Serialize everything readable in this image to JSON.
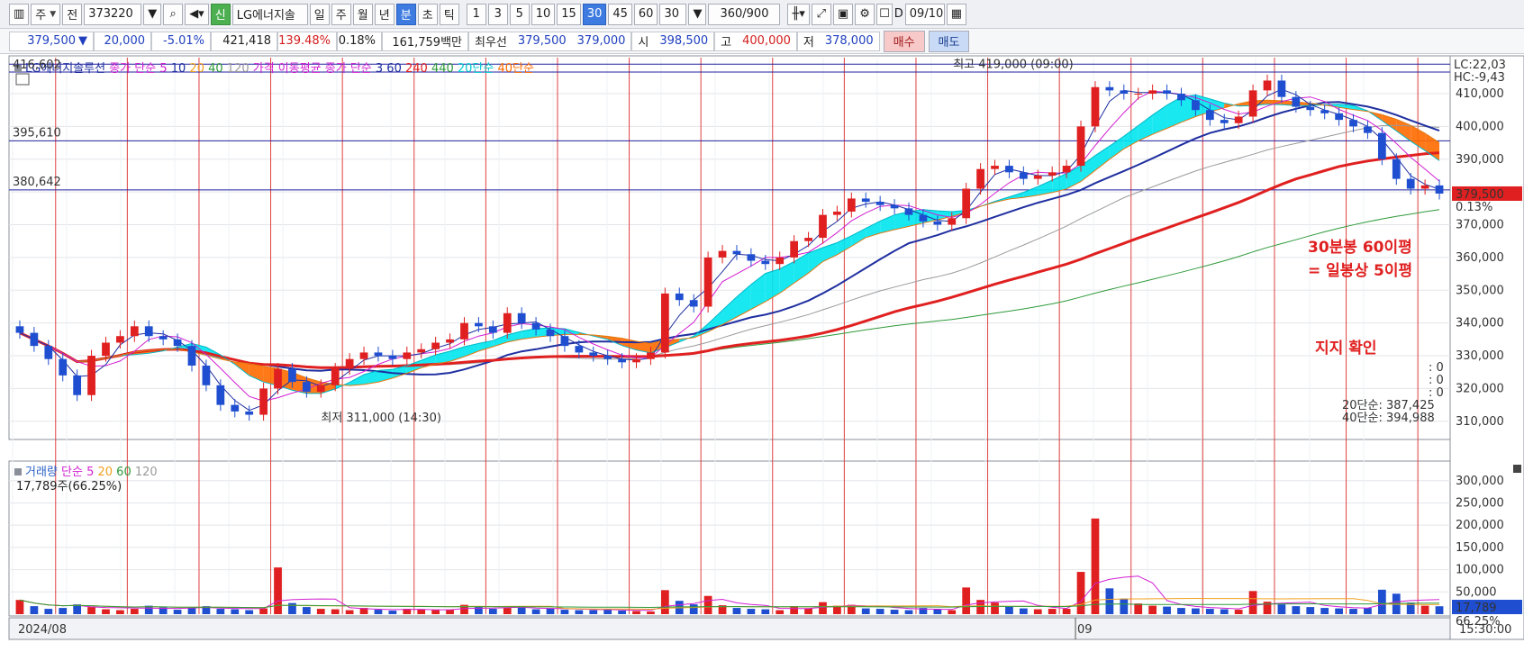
{
  "toolbar": {
    "period_combo": "주",
    "prev_label": "전",
    "code": "373220",
    "new_badge": "신",
    "stock_name": "LG에너지솔",
    "periods": [
      "일",
      "주",
      "월",
      "년",
      "분",
      "초",
      "틱"
    ],
    "active_period": "분",
    "minutes": [
      "1",
      "3",
      "5",
      "10",
      "15",
      "30",
      "45",
      "60"
    ],
    "active_minute": "30",
    "minute_combo": "30",
    "count_value": "360",
    "count_total": "/900",
    "checkbox_label": "D",
    "date": "09/10"
  },
  "quote": {
    "price": "379,500",
    "change_arrow": "▼",
    "change": "20,000",
    "change_rate": "-5.01%",
    "volume": "421,418",
    "volume_ratio": "139.48%",
    "turnover_rate": "0.18%",
    "amount": "161,759백만",
    "best_label": "최우선",
    "best_ask": "379,500",
    "best_bid": "379,000",
    "open_label": "시",
    "open": "398,500",
    "high_label": "고",
    "high": "400,000",
    "low_label": "저",
    "low": "378,000",
    "buy_label": "매수",
    "sell_label": "매도"
  },
  "colors": {
    "up": "#e02020",
    "down": "#1f4fd0",
    "ma5": "#d21fd2",
    "ma10": "#1f2fa0",
    "ma60": "#e02020",
    "ma120": "#9a9a9a",
    "ma240": "#e02020",
    "ma440": "#2e9a3a",
    "band_a": "#00e5ee",
    "band_b": "#ff6a00",
    "vline": "#e04040",
    "hline": "#2020a0"
  },
  "chart_data": {
    "type": "line",
    "price_legend_title": "LG에너지솔루션",
    "price_legend": [
      {
        "label": "종가 단순",
        "color": "#d21fd2"
      },
      {
        "label": "5",
        "color": "#d21fd2"
      },
      {
        "label": "10",
        "color": "#1f2fa0"
      },
      {
        "label": "20",
        "color": "#f0a020"
      },
      {
        "label": "40",
        "color": "#2e9a3a"
      },
      {
        "label": "120",
        "color": "#9a9a9a"
      },
      {
        "label": "가격 이동평균",
        "color": "#d21fd2"
      },
      {
        "label": "종가 단순",
        "color": "#d21fd2"
      },
      {
        "label": "3",
        "color": "#1f2fa0"
      },
      {
        "label": "60",
        "color": "#1f2fa0"
      },
      {
        "label": "240",
        "color": "#e02020"
      },
      {
        "label": "440",
        "color": "#2e9a3a"
      },
      {
        "label": "20단순",
        "color": "#00c8d0"
      },
      {
        "label": "40단순",
        "color": "#ff6a00"
      }
    ],
    "price_axis_ticks": [
      "410,000",
      "400,000",
      "390,000",
      "380,000",
      "370,000",
      "360,000",
      "350,000",
      "340,000",
      "330,000",
      "320,000",
      "310,000"
    ],
    "price_tick_values": [
      410000,
      400000,
      390000,
      380000,
      370000,
      360000,
      350000,
      340000,
      330000,
      320000,
      310000
    ],
    "ylim": [
      305000,
      421000
    ],
    "left_level_labels": [
      {
        "label": "416,602",
        "value": 416602
      },
      {
        "label": "395,610",
        "value": 395610
      },
      {
        "label": "380,642",
        "value": 380642
      }
    ],
    "hlines": [
      419000,
      416602,
      395610,
      380642
    ],
    "right_top_labels": [
      "LC:22,03",
      "HC:-9,43"
    ],
    "current_price_label": "379,500",
    "current_change_label": "0.13%",
    "current_price_value": 379500,
    "high_marker": {
      "label": "최고 419,000 (09:00)",
      "value": 419000,
      "x": 72
    },
    "low_marker": {
      "label": "최저 311,000 (14:30)",
      "value": 311000,
      "x": 20
    },
    "annotation_lines": [
      "30분봉 60이평",
      "= 일봉상 5이평"
    ],
    "support_label": "지지 확인",
    "right_values": [
      ": 0",
      ": 0",
      ": 0"
    ],
    "ma20_readout": "20단순: 387,425",
    "ma40_readout": "40단순: 394,988",
    "bars_count": 100,
    "close_series": [
      337000,
      333000,
      329000,
      324000,
      318000,
      330000,
      334000,
      336000,
      339000,
      336000,
      335000,
      333000,
      327000,
      321000,
      315000,
      313000,
      312000,
      320000,
      326000,
      322000,
      319000,
      321000,
      326000,
      329000,
      331000,
      330000,
      329000,
      331000,
      332000,
      334000,
      335000,
      340000,
      339000,
      337000,
      343000,
      340000,
      338000,
      336000,
      333000,
      331000,
      330000,
      329000,
      328000,
      329000,
      331000,
      349000,
      347000,
      345000,
      360000,
      362000,
      361000,
      359000,
      358000,
      360000,
      365000,
      366000,
      373000,
      374000,
      378000,
      377000,
      376000,
      375000,
      373000,
      371000,
      370000,
      372000,
      381000,
      387000,
      388000,
      386000,
      384000,
      385000,
      386000,
      388000,
      400000,
      412000,
      411000,
      410000,
      410000,
      411000,
      410000,
      408000,
      405000,
      402000,
      401000,
      403000,
      411000,
      414000,
      409000,
      406000,
      405000,
      404000,
      402000,
      400000,
      398000,
      390000,
      384000,
      381000,
      382000,
      379500
    ],
    "volume_legend": [
      {
        "label": "거래량",
        "color": "#2d62c8"
      },
      {
        "label": "단순",
        "color": "#d21fd2"
      },
      {
        "label": "5",
        "color": "#d21fd2"
      },
      {
        "label": "20",
        "color": "#f0a020"
      },
      {
        "label": "60",
        "color": "#2e9a3a"
      },
      {
        "label": "120",
        "color": "#9a9a9a"
      }
    ],
    "volume_readout": "17,789주(66.25%)",
    "volume_axis_ticks": [
      "300,000",
      "250,000",
      "200,000",
      "150,000",
      "100,000",
      "50,000"
    ],
    "volume_tick_values": [
      300000,
      250000,
      200000,
      150000,
      100000,
      50000
    ],
    "volume_ylim": [
      0,
      340000
    ],
    "volume_current_label": "17,789",
    "volume_current_pct": "66.25%",
    "volume_series": [
      32000,
      18000,
      12000,
      14000,
      22000,
      16000,
      11000,
      9000,
      12000,
      19000,
      15000,
      10000,
      14000,
      18000,
      12000,
      11000,
      9000,
      13000,
      105000,
      25000,
      16000,
      12000,
      11000,
      9000,
      14000,
      10000,
      8000,
      12000,
      11000,
      9000,
      10000,
      21000,
      16000,
      12000,
      14000,
      15000,
      11000,
      13000,
      10000,
      9000,
      9000,
      12000,
      8000,
      7000,
      6000,
      54000,
      30000,
      22000,
      41000,
      20000,
      14000,
      12000,
      11000,
      9000,
      18000,
      13000,
      27000,
      19000,
      21000,
      13000,
      12000,
      10000,
      9000,
      14000,
      11000,
      9000,
      60000,
      32000,
      26000,
      17000,
      13000,
      11000,
      12000,
      12000,
      95000,
      215000,
      58000,
      35000,
      24000,
      19000,
      17000,
      14000,
      13000,
      12000,
      11000,
      10000,
      52000,
      28000,
      22000,
      18000,
      16000,
      14000,
      13000,
      12000,
      14000,
      55000,
      46000,
      26000,
      19000,
      17789
    ],
    "x_axis_labels": [
      {
        "label": "2024/08",
        "index": 0
      },
      {
        "label": "09",
        "index": 74
      }
    ],
    "time_readout": "15:30:00"
  }
}
